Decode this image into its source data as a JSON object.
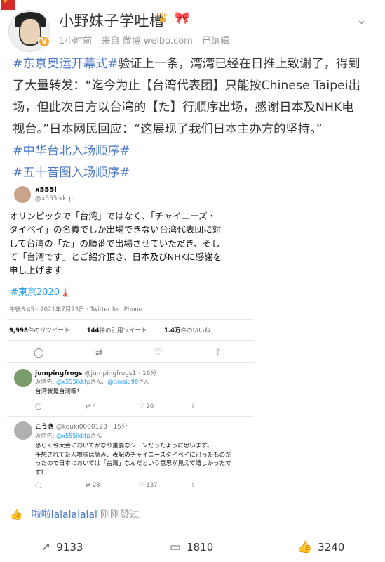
{
  "header": {
    "name": "小野妹子学吐槽",
    "meta": {
      "time": "1小时前",
      "source": "来自 微博 weibo.com",
      "edited": "已编辑"
    }
  },
  "post": {
    "lines": [
      [
        {
          "t": "#东京奥运开幕式#",
          "tag": true
        },
        {
          "t": "验证上一条，湾湾已经在日推上致谢了，得到",
          "tag": false
        }
      ],
      [
        {
          "t": "了大量转发：“迄今为止【台湾代表团】只能按Chinese Taipei出",
          "tag": false
        }
      ],
      [
        {
          "t": "场，但此次日方以台湾的【た】行顺序出场，感谢日本及NHK电",
          "tag": false
        }
      ],
      [
        {
          "t": "视台。”日本网民回应：“这展现了我们日本主办方的坚持。”",
          "tag": false
        }
      ],
      [
        {
          "t": "#中华台北入场顺序#",
          "tag": true
        }
      ],
      [
        {
          "t": "#五十音图入场顺序#",
          "tag": true
        }
      ]
    ]
  },
  "tweet": {
    "name": "x555l",
    "handle": "@x555lkktp",
    "body": [
      "オリンピックで「台湾」ではなく、「チャイニーズ・",
      "タイペイ」の名義でしか出場できない台湾代表団に対",
      "して台湾の「た」の順番で出場させていただき、そし",
      "て「台湾です」とご紹介頂き、日本及びNHKに感謝を",
      "申し上げます"
    ],
    "hashtag": "#東京2020🗼",
    "time": "午後8:45 · 2021年7月23日 · Twitter for iPhone",
    "stats": {
      "retweets": "9,998",
      "retweets_label": "件のリツイート",
      "quotes": "144",
      "quotes_label": "件の引用ツイート",
      "likes": "1.4万",
      "likes_label": "件のいいね"
    }
  },
  "replies": [
    {
      "name": "jumpingfrogs",
      "handle": "@jumpingfrogs1 · 16分",
      "reply_prefix": "返信先: ",
      "reply_to": "@x555lkktp",
      "reply_mid": "さん、",
      "reply_to2": "@timsid99",
      "reply_suffix": "さん",
      "text": [
        "台湾就是台灣啊!"
      ],
      "retweets": "4",
      "likes": "26"
    },
    {
      "name": "こうき",
      "handle": "@kouki0000123 · 15分",
      "reply_prefix": "返信先: ",
      "reply_to": "@x555lkktp",
      "reply_mid": "さん",
      "reply_to2": "",
      "reply_suffix": "",
      "text": [
        "恐らく今大会においてかなり重要なシーンだったように思います。",
        "予想されてた入場順は読み、表記のチャイニーズタイペイに沿ったものだ",
        "ったので日本においては「台湾」なんだという意思が見えて嬉しかったで",
        "す!"
      ],
      "retweets": "23",
      "likes": "137"
    }
  ],
  "liked_by": {
    "user": "啦啦lalalalalal",
    "text": "刚刚赞过"
  },
  "bottom": {
    "reposts": "9133",
    "comments": "1810",
    "likes": "3240"
  },
  "colors": {
    "link": "#4a79c7",
    "twitter_blue": "#1d9bf0"
  }
}
